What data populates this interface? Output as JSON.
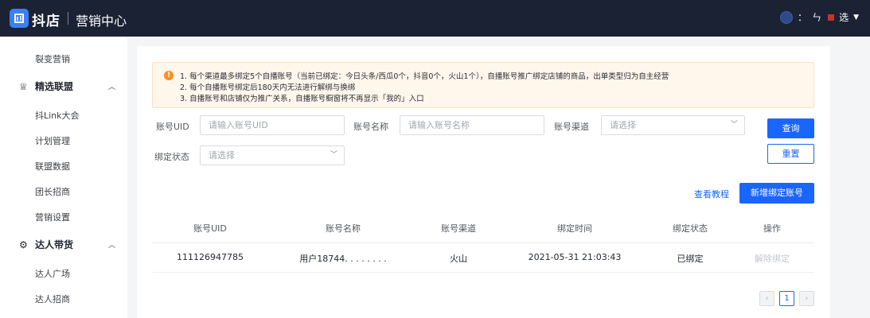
{
  "header": {
    "logo_text": "抖店",
    "app_title": "营销中心",
    "user_name": "选",
    "user_name_prefix": "：",
    "user_name_mid": "ㄣ"
  },
  "sidebar": {
    "items_top": [
      "裂变营销"
    ],
    "group1": {
      "label": "精选联盟",
      "items": [
        "抖Link大会",
        "计划管理",
        "联盟数据",
        "团长招商",
        "营销设置"
      ]
    },
    "group2": {
      "label": "达人带货",
      "items": [
        "达人广场",
        "达人招商"
      ]
    }
  },
  "notice": {
    "lines": [
      "1. 每个渠道最多绑定5个自播账号（当前已绑定：今日头条/西瓜0个，抖音0个，火山1个），自播账号推广绑定店铺的商品，出单类型归为自主经营",
      "2. 每个自播账号绑定后180天内无法进行解绑与换绑",
      "3. 自播账号和店铺仅为推广关系，自播账号橱窗将不再显示「我的」入口"
    ]
  },
  "filters": {
    "uid": {
      "label": "账号UID",
      "placeholder": "请输入账号UID"
    },
    "name": {
      "label": "账号名称",
      "placeholder": "请输入账号名称"
    },
    "channel": {
      "label": "账号渠道",
      "placeholder": "请选择"
    },
    "status": {
      "label": "绑定状态",
      "placeholder": "请选择"
    }
  },
  "actions": {
    "query": "查询",
    "reset": "重置",
    "tutorial": "查看教程",
    "add_account": "新增绑定账号"
  },
  "table": {
    "columns": [
      "账号UID",
      "账号名称",
      "账号渠道",
      "绑定时间",
      "绑定状态",
      "操作"
    ],
    "rows": [
      {
        "uid": "111126947785",
        "name": "用户18744. . . . . . . .",
        "channel": "火山",
        "bind_time": "2021-05-31 21:03:43",
        "status": "已绑定",
        "action": "解除绑定"
      }
    ]
  },
  "pagination": {
    "prev": "‹",
    "current": "1",
    "next": "›"
  },
  "colors": {
    "topbar": "#1a2233",
    "primary": "#1966ff",
    "notice_bg": "#fff6ec",
    "notice_icon": "#ff8f1f"
  }
}
